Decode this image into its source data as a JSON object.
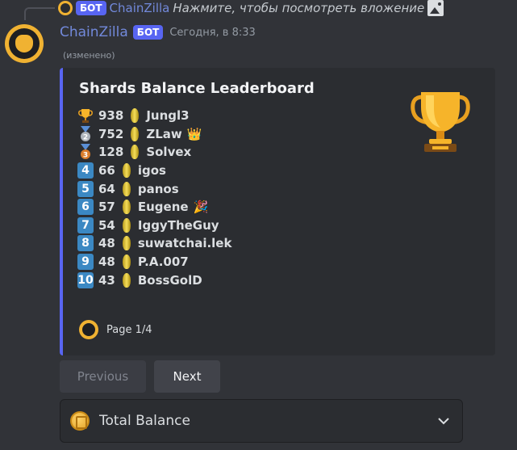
{
  "reply": {
    "bot_tag": "БОТ",
    "author": "ChainZilla",
    "text": "Нажмите, чтобы посмотреть вложение"
  },
  "message": {
    "author": "ChainZilla",
    "bot_tag": "БОТ",
    "timestamp": "Сегодня, в 8:33",
    "edited": "(изменено)"
  },
  "embed": {
    "title": "Shards Balance Leaderboard",
    "accent_color": "#5865f2",
    "thumbnail_icon": "trophy-icon",
    "leaderboard": [
      {
        "rank": "1",
        "rank_style": "trophy",
        "value": "938",
        "name": "Jungl3",
        "suffix": ""
      },
      {
        "rank": "2",
        "rank_style": "medal-silver",
        "value": "752",
        "name": "ZLaw",
        "suffix": "👑"
      },
      {
        "rank": "3",
        "rank_style": "medal-bronze",
        "value": "128",
        "name": "Solvex",
        "suffix": ""
      },
      {
        "rank": "4",
        "rank_style": "box",
        "value": "66",
        "name": "igos",
        "suffix": ""
      },
      {
        "rank": "5",
        "rank_style": "box",
        "value": "64",
        "name": "panos",
        "suffix": ""
      },
      {
        "rank": "6",
        "rank_style": "box",
        "value": "57",
        "name": "Eugene",
        "suffix": "🎉"
      },
      {
        "rank": "7",
        "rank_style": "box",
        "value": "54",
        "name": "IggyTheGuy",
        "suffix": ""
      },
      {
        "rank": "8",
        "rank_style": "box",
        "value": "48",
        "name": "suwatchai.lek",
        "suffix": ""
      },
      {
        "rank": "9",
        "rank_style": "box",
        "value": "48",
        "name": "P.A.007",
        "suffix": ""
      },
      {
        "rank": "10",
        "rank_style": "box",
        "value": "43",
        "name": "BossGolD",
        "suffix": ""
      }
    ],
    "footer": "Page 1/4"
  },
  "buttons": {
    "previous": "Previous",
    "next": "Next"
  },
  "select": {
    "icon": "coin-icon",
    "value": "Total Balance"
  }
}
